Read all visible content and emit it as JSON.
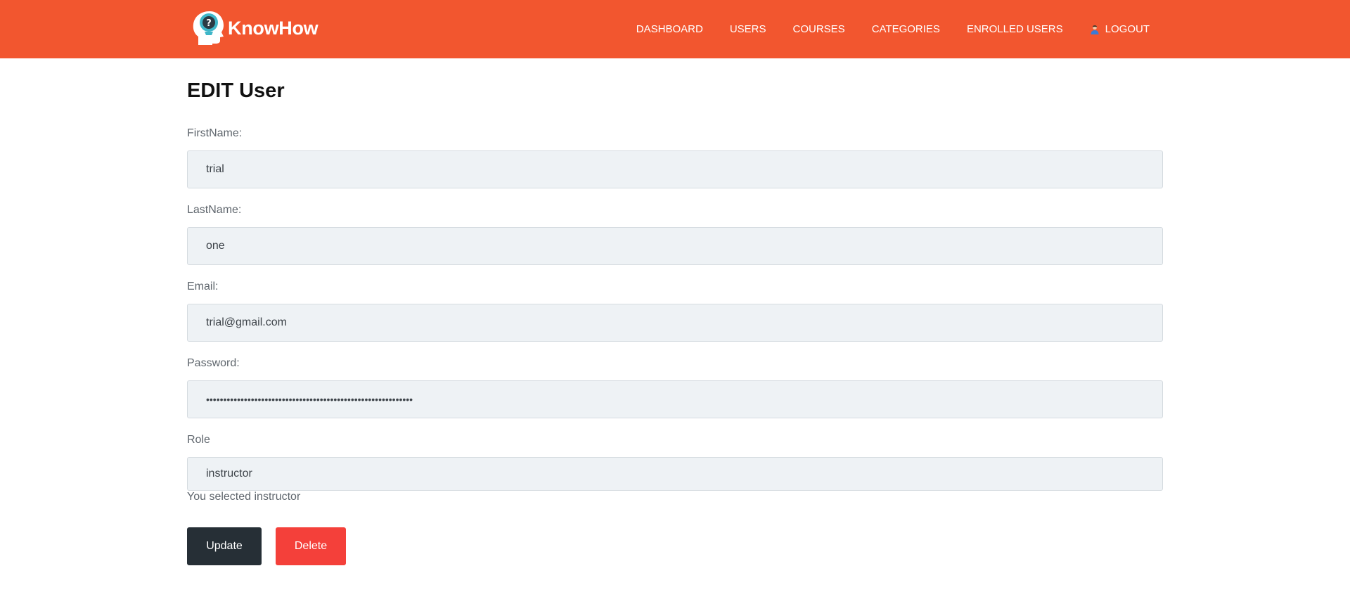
{
  "brand": {
    "name": "KnowHow",
    "logo_icon": "head-question-icon"
  },
  "nav": {
    "items": [
      {
        "label": "DASHBOARD"
      },
      {
        "label": "USERS"
      },
      {
        "label": "COURSES"
      },
      {
        "label": "CATEGORIES"
      },
      {
        "label": "ENROLLED USERS"
      }
    ],
    "logout": {
      "label": "LOGOUT",
      "icon": "user-icon"
    }
  },
  "page": {
    "title": "EDIT User"
  },
  "form": {
    "first_name": {
      "label": "FirstName:",
      "value": "trial"
    },
    "last_name": {
      "label": "LastName:",
      "value": "one"
    },
    "email": {
      "label": "Email:",
      "value": "trial@gmail.com"
    },
    "password": {
      "label": "Password:",
      "value": "••••••••••••••••••••••••••••••••••••••••••••••••••••••••••••"
    },
    "role": {
      "label": "Role",
      "value": "instructor",
      "hint": "You selected instructor"
    }
  },
  "actions": {
    "update_label": "Update",
    "delete_label": "Delete"
  },
  "colors": {
    "navbar": "#f2562f",
    "update": "#262f36",
    "delete": "#f4403a",
    "field_bg": "#eef2f5"
  }
}
